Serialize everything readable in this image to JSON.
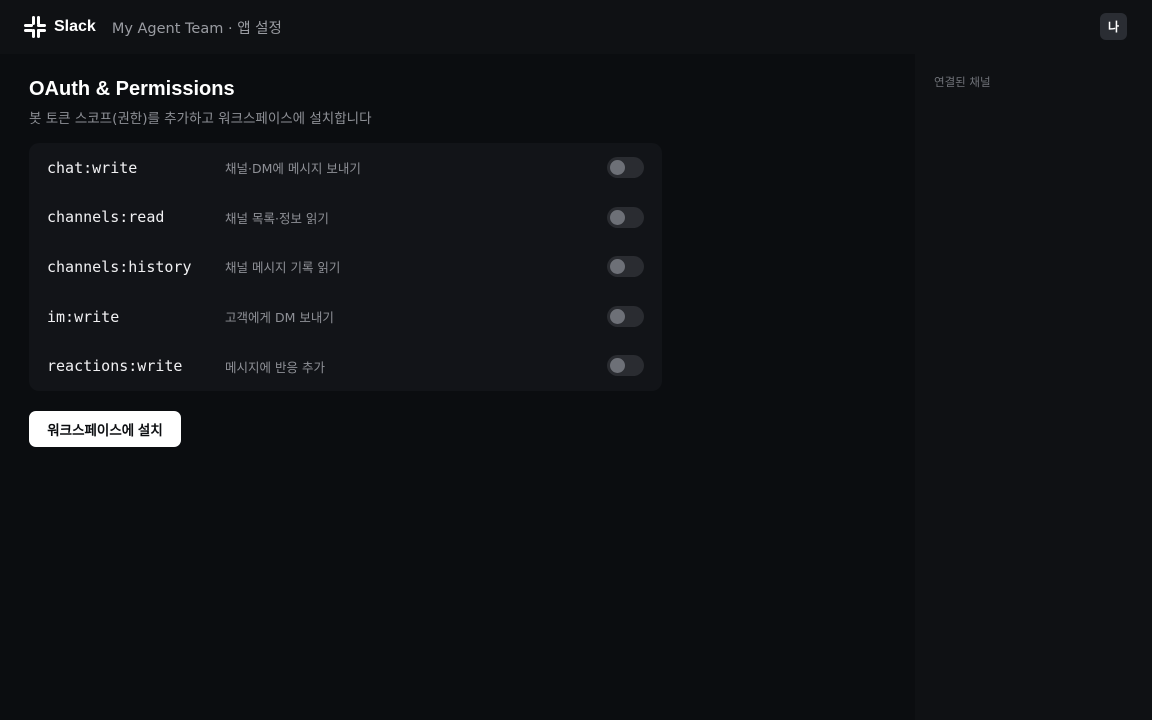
{
  "topbar": {
    "brand": "Slack",
    "context": "My Agent Team · 앱 설정",
    "avatar": "나"
  },
  "page": {
    "title": "OAuth & Permissions",
    "subtitle": "봇 토큰 스코프(권한)를 추가하고 워크스페이스에 설치합니다"
  },
  "scopes": [
    {
      "name": "chat:write",
      "desc": "채널·DM에 메시지 보내기",
      "enabled": false
    },
    {
      "name": "channels:read",
      "desc": "채널 목록·정보 읽기",
      "enabled": false
    },
    {
      "name": "channels:history",
      "desc": "채널 메시지 기록 읽기",
      "enabled": false
    },
    {
      "name": "im:write",
      "desc": "고객에게 DM 보내기",
      "enabled": false
    },
    {
      "name": "reactions:write",
      "desc": "메시지에 반응 추가",
      "enabled": false
    }
  ],
  "install_button": "워크스페이스에 설치",
  "sidebar": {
    "title": "연결된 채널"
  },
  "colors": {
    "logo_blue": "#36c5f0",
    "logo_green": "#2eb67d",
    "logo_yellow": "#ecb22e",
    "logo_red": "#e01e5a"
  }
}
